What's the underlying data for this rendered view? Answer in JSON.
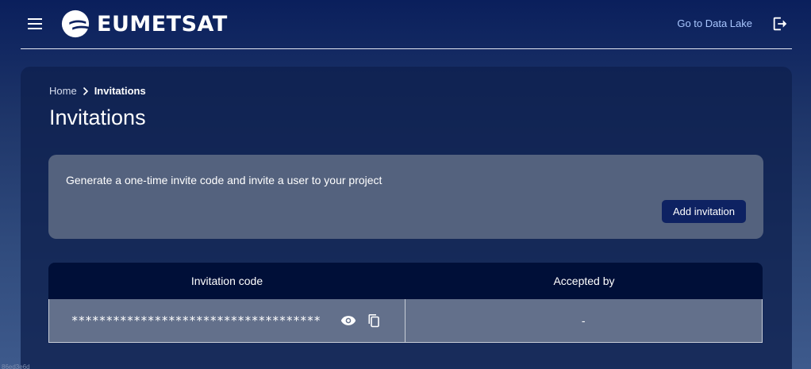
{
  "header": {
    "logo_text": "EUMETSAT",
    "datalake_link": "Go to Data Lake",
    "icons": {
      "menu": "menu-icon",
      "logout": "logout-icon",
      "logo": "eumetsat-logo-icon"
    }
  },
  "breadcrumb": {
    "home": "Home",
    "current": "Invitations"
  },
  "page": {
    "title": "Invitations"
  },
  "info_panel": {
    "text": "Generate a one-time invite code and invite a user to your project",
    "add_button": "Add invitation"
  },
  "table": {
    "columns": [
      "Invitation code",
      "Accepted by"
    ],
    "rows": [
      {
        "code": "************************************",
        "accepted_by": "-"
      }
    ]
  },
  "footer": {
    "hash": "86ed3e6d"
  },
  "colors": {
    "accent_button": "#0e2262",
    "table_header": "#000f38",
    "link": "#a9c7ff"
  }
}
